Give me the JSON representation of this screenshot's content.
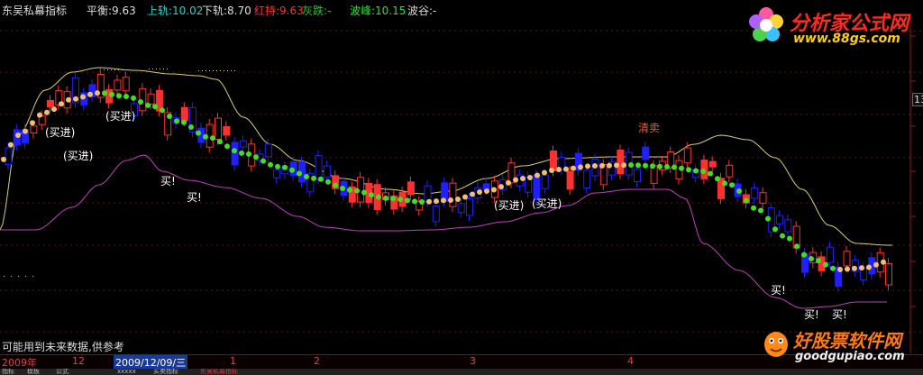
{
  "header": {
    "indicator_name": "东吴私幕指标",
    "balance": "平衡:9.63",
    "upper": "上轨:10.02",
    "lower": "下轨:8.70",
    "red_hold": "红持:9.63",
    "gray_fall": "灰跌:-",
    "wave_peak": "波峰:10.15",
    "wave_trough": "波谷:-"
  },
  "right_scale_label": "13",
  "signals": {
    "buy_in": "(买进)",
    "buy": "买!",
    "clear_sell": "清卖"
  },
  "footer_note": "可能用到未来数据,供参考",
  "x_axis": {
    "labels": [
      "2009年",
      "12",
      "1",
      "2",
      "3",
      "4"
    ],
    "selected_date": "2009/12/09/三"
  },
  "bottom_tabs": [
    "指标",
    "模板",
    "公式",
    "xxxxx",
    "买卖指标",
    "东吴私幕指标"
  ],
  "watermarks": {
    "top_title": "分析家公式网",
    "top_url": "www.88gs.com",
    "bottom_title": "好股票软件网",
    "bottom_url": "goodgupiao.com"
  },
  "colors": {
    "background": "#000000",
    "grid": "#6a1010",
    "up_candle": "#ff3030",
    "down_candle": "#2020ff",
    "upper_band": "#d8d070",
    "lower_band": "#c040c0",
    "dots_bull": "#f0c070",
    "dots_bear": "#40e020"
  },
  "chart_data": {
    "type": "line",
    "title": "",
    "note": "",
    "series_points": 100
  }
}
